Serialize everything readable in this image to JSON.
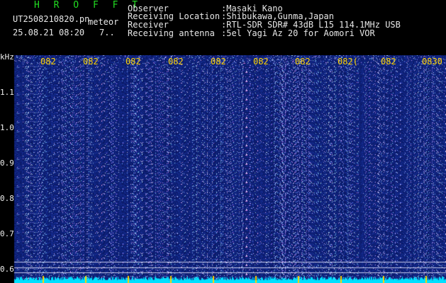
{
  "app_title": "H R O F F T",
  "file_name": "UT2508210820.pn",
  "file_suffix": "meteor",
  "date_time": "25.08.21 08:20",
  "count_text": "7..",
  "info": [
    {
      "label": "Observer",
      "value": ":Masaki Kano"
    },
    {
      "label": "Receiving Location",
      "value": ":Shibukawa,Gunma,Japan"
    },
    {
      "label": "Receiver",
      "value": ":RTL-SDR SDR# 43dB L15 114.1MHz USB"
    },
    {
      "label": "Receiving antenna",
      "value": ":5el Yagi Az 20 for Aomori VOR"
    }
  ],
  "y_axis": {
    "unit": "kHz",
    "ticks": [
      "1.1",
      "1.0",
      "0.9",
      "0.8",
      "0.7",
      "0.6"
    ]
  },
  "time_labels": [
    "082",
    "082",
    "082",
    "082",
    "082",
    "082",
    "082",
    "082(",
    "082",
    "0830"
  ],
  "colors": {
    "background": "#000000",
    "spectrogram_base": "#0a1a7a",
    "title_green": "#22dd22",
    "time_label_yellow": "#ffd400",
    "header_text": "#e8e8e8",
    "signal_cyan": "#00e0ff"
  }
}
